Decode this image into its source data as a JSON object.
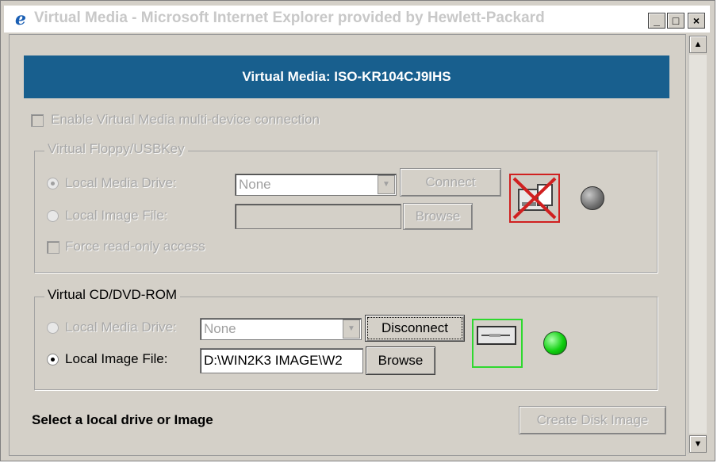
{
  "window": {
    "title": "Virtual Media - Microsoft Internet Explorer provided by Hewlett-Packard",
    "minimize": "_",
    "maximize": "□",
    "close": "×"
  },
  "banner": {
    "title": "Virtual Media: ISO-KR104CJ9IHS"
  },
  "multi_device": {
    "label": "Enable Virtual Media multi-device connection",
    "checked": false,
    "enabled": false
  },
  "floppy": {
    "legend": "Virtual Floppy/USBKey",
    "local_media_label": "Local Media Drive:",
    "local_media_selected": true,
    "drive_value": "None",
    "connect_label": "Connect",
    "image_file_label": "Local Image File:",
    "image_file_value": "",
    "browse_label": "Browse",
    "readonly_label": "Force read-only access",
    "status_icon": "floppy-disconnected-icon",
    "led": "gray",
    "enabled": false
  },
  "cdrom": {
    "legend": "Virtual CD/DVD-ROM",
    "local_media_label": "Local Media Drive:",
    "drive_value": "None",
    "disconnect_label": "Disconnect",
    "image_file_label": "Local Image File:",
    "image_file_selected": true,
    "image_file_value": "D:\\WIN2K3 IMAGE\\W2",
    "browse_label": "Browse",
    "status_icon": "cd-drive-connected-icon",
    "led": "green"
  },
  "footer": {
    "status": "Select a local drive or Image",
    "create_disk_image_label": "Create Disk Image"
  },
  "colors": {
    "banner": "#185f8e",
    "window_bg": "#d4d0c8",
    "floppy_border": "#d02020",
    "cd_border": "#2fd82f",
    "led_green": "#10d010",
    "led_gray": "#6e6e6e"
  }
}
